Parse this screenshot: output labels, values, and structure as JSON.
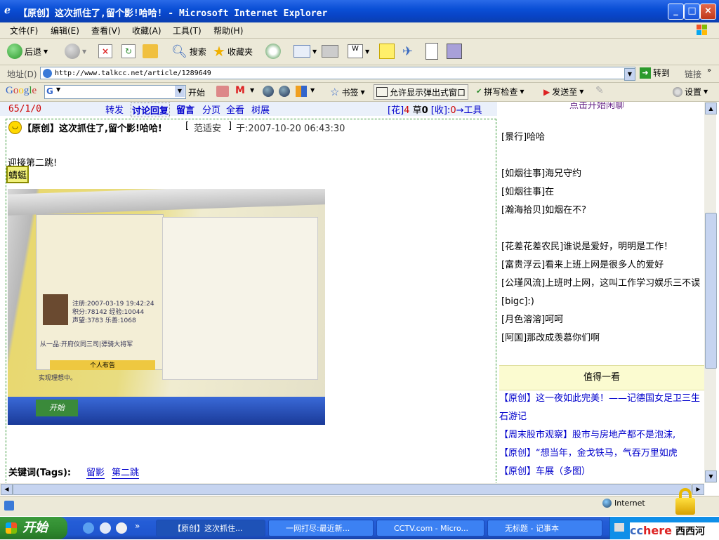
{
  "window": {
    "title": "【原创】这次抓住了,留个影!哈哈! - Microsoft Internet Explorer",
    "min_label": "_",
    "max_label": "□",
    "close_label": "×"
  },
  "menu": [
    "文件(F)",
    "编辑(E)",
    "查看(V)",
    "收藏(A)",
    "工具(T)",
    "帮助(H)"
  ],
  "toolbar": {
    "back": "后退",
    "search": "搜索",
    "favorites": "收藏夹"
  },
  "address": {
    "label": "地址(D)",
    "url": "http://www.talkcc.net/article/1289649",
    "go": "转到",
    "links": "链接"
  },
  "google": {
    "logo": "Google",
    "g_label": "G",
    "start": "开始",
    "bookmarks": "书签",
    "popup": "允许显示弹出式窗口",
    "spell": "拼写检查",
    "send": "发送至",
    "settings": "设置"
  },
  "topnav": {
    "counter": "65/1/0",
    "links": [
      "转发",
      "讨论回复",
      "留言",
      "分页",
      "全看",
      "树展"
    ],
    "hua_label": "[花]",
    "hua_count": "4",
    "cao_label": "草",
    "cao_count": "0",
    "shou_label": "[收]:",
    "shou_count": "0",
    "tools": "→工具"
  },
  "post": {
    "title": "【原创】这次抓住了,留个影!哈哈!",
    "author_prefix": "[",
    "author": "范适安",
    "author_suffix": "]",
    "date": "于:2007-10-20 06:43:30",
    "body": "迎接第二跳!",
    "tag_box": "蜻蜓",
    "tags_label": "关键词(Tags):",
    "tags": [
      "留影",
      "第二跳"
    ]
  },
  "screenshot_photo": {
    "start_label": "开始",
    "lines": [
      "注册:2007-03-19 19:42:24",
      "积分:78142 经验:10044",
      "声望:3783 乐善:1068",
      "从一品:开府仪同三司|骠骑大将军",
      "个人布告",
      "实现理想中。"
    ]
  },
  "sidebar": {
    "top_link": "点击开始闲聊",
    "chat": [
      "[景行]哈哈",
      "",
      "[如烟往事]海兄守约",
      "[如烟往事]在",
      "[瀚海拾贝]如烟在不?",
      "",
      "[花差花差农民]谁说是爱好，明明是工作！",
      "[富贵浮云]看来上班上网是很多人的爱好",
      "[公瑾风流]上班时上网，这叫工作学习娱乐三不误",
      "[bigc]:)",
      "[月色溶溶]呵呵",
      "[阿国]那改成羡慕你们啊"
    ],
    "section_title": "值得一看",
    "items": [
      "【原创】这一夜如此完美！——记德国女足卫三生石游记",
      "【周末股市观察】股市与房地产都不是泡沫,",
      "【原创】“想当年，金戈铁马，气吞万里如虎",
      "【原创】车展（多图）"
    ]
  },
  "status": {
    "zone": "Internet"
  },
  "taskbar": {
    "start": "开始",
    "tasks": [
      "【原创】这次抓住...",
      "一网打尽:最近新...",
      "CCTV.com - Micro...",
      "无标题 - 记事本"
    ],
    "tray_cc": "cc",
    "tray_here": "here",
    "tray_text": "西西河"
  }
}
